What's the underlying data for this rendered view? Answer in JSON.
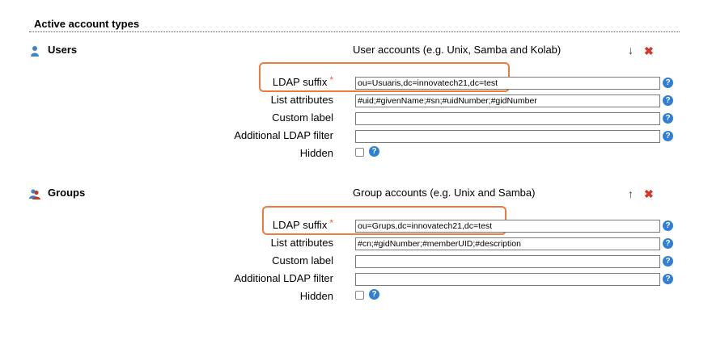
{
  "header": {
    "title": "Active account types"
  },
  "labels": {
    "ldap_suffix": "LDAP suffix",
    "list_attributes": "List attributes",
    "custom_label": "Custom label",
    "additional_filter": "Additional LDAP filter",
    "hidden": "Hidden",
    "required_mark": "*",
    "help": "?"
  },
  "users": {
    "name": "Users",
    "description": "User accounts (e.g. Unix, Samba and Kolab)",
    "ldap_suffix": "ou=Usuaris,dc=innovatech21,dc=test",
    "list_attributes": "#uid;#givenName;#sn;#uidNumber;#gidNumber",
    "custom_label": "",
    "additional_filter": "",
    "move_icon": "arrow-down-icon",
    "move_glyph": "↓",
    "remove_glyph": "✖"
  },
  "groups": {
    "name": "Groups",
    "description": "Group accounts (e.g. Unix and Samba)",
    "ldap_suffix": "ou=Grups,dc=innovatech21,dc=test",
    "list_attributes": "#cn;#gidNumber;#memberUID;#description",
    "custom_label": "",
    "additional_filter": "",
    "move_icon": "arrow-up-icon",
    "move_glyph": "↑",
    "remove_glyph": "✖"
  },
  "colors": {
    "highlight": "#f07a3c",
    "help": "#2f7fd6",
    "remove": "#d6352a",
    "required": "#e8622a"
  }
}
